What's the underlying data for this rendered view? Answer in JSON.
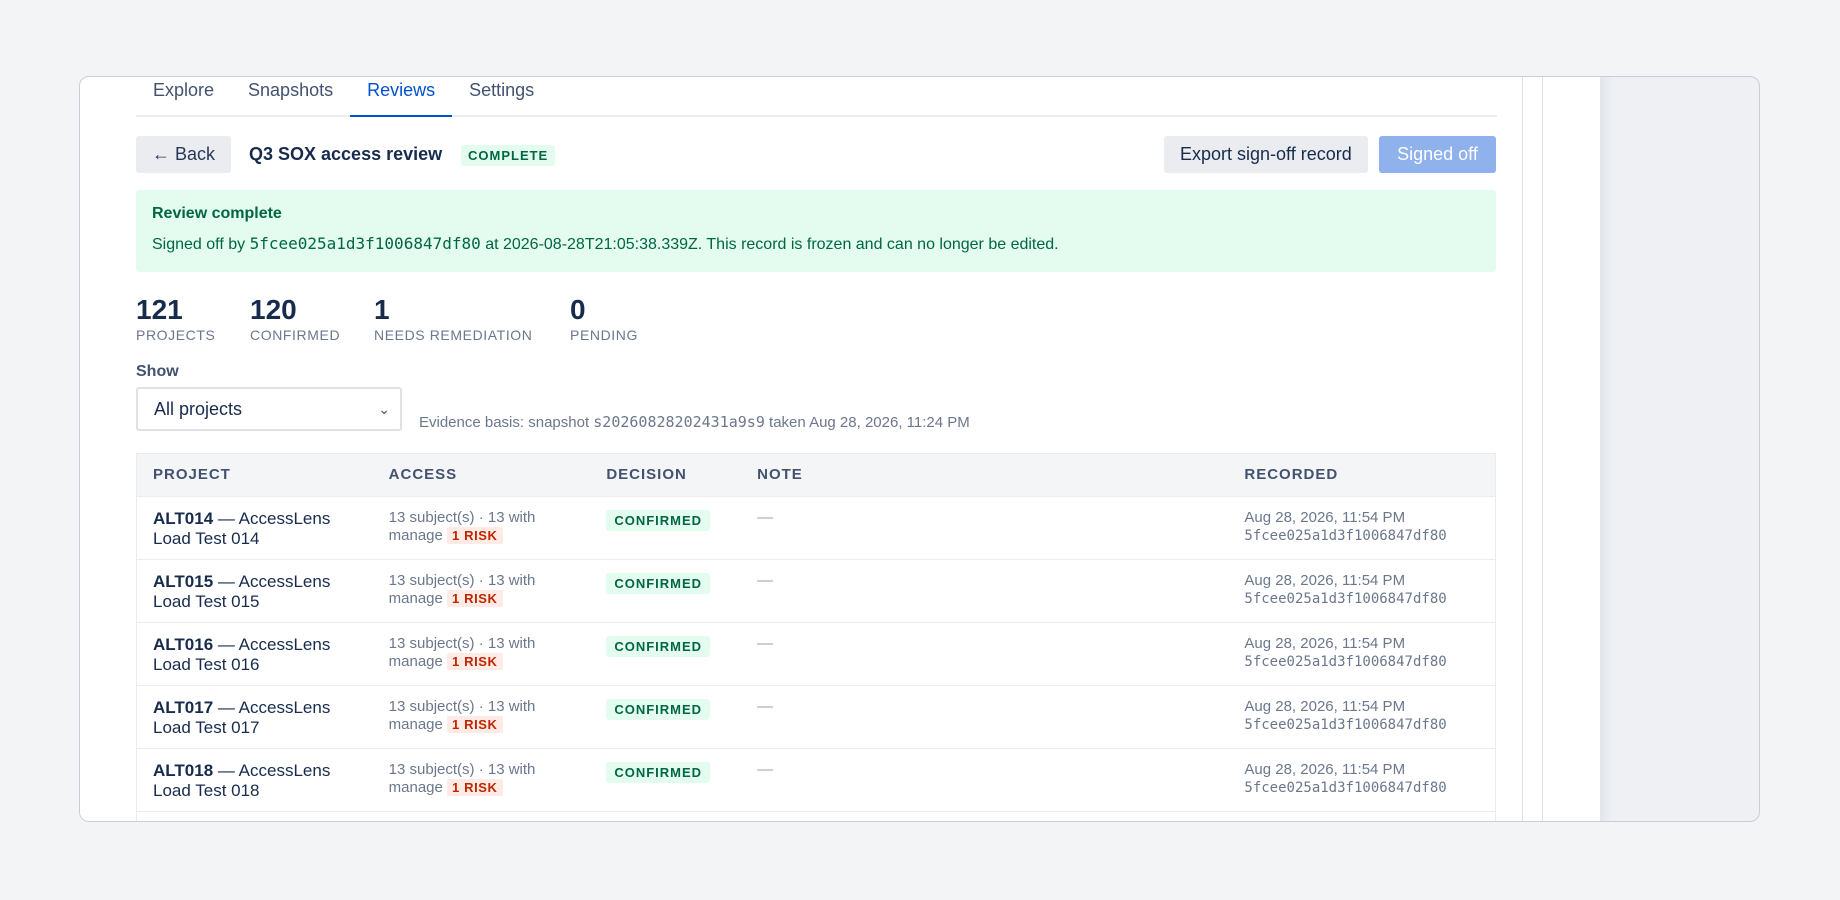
{
  "tabs": [
    {
      "label": "Explore"
    },
    {
      "label": "Snapshots"
    },
    {
      "label": "Reviews",
      "active": true
    },
    {
      "label": "Settings"
    }
  ],
  "header": {
    "back_label": "← Back",
    "title": "Q3 SOX access review",
    "status_badge": "COMPLETE",
    "export_label": "Export sign-off record",
    "signed_label": "Signed off"
  },
  "banner": {
    "title": "Review complete",
    "prefix": "Signed off by ",
    "signer": "5fcee025a1d3f1006847df80",
    "at_text": " at 2026-08-28T21:05:38.339Z. This record is frozen and can no longer be edited."
  },
  "stats": [
    {
      "value": "121",
      "label": "PROJECTS"
    },
    {
      "value": "120",
      "label": "CONFIRMED"
    },
    {
      "value": "1",
      "label": "NEEDS REMEDIATION"
    },
    {
      "value": "0",
      "label": "PENDING"
    }
  ],
  "filter": {
    "label": "Show",
    "selected": "All projects",
    "evidence_prefix": "Evidence basis: snapshot ",
    "snapshot_id": "s20260828202431a9s9",
    "evidence_suffix": " taken Aug 28, 2026, 11:24 PM"
  },
  "table": {
    "columns": [
      "PROJECT",
      "ACCESS",
      "DECISION",
      "NOTE",
      "RECORDED"
    ],
    "rows": [
      {
        "key": "ALT014",
        "name_line1": " — AccessLens",
        "name_line2": "Load Test 014",
        "access_line1": "13 subject(s) · 13 with",
        "access_line2": "manage",
        "risk": "1 RISK",
        "decision": "CONFIRMED",
        "note": "—",
        "recorded_date": "Aug 28, 2026, 11:54 PM",
        "recorded_by": "5fcee025a1d3f1006847df80"
      },
      {
        "key": "ALT015",
        "name_line1": " — AccessLens",
        "name_line2": "Load Test 015",
        "access_line1": "13 subject(s) · 13 with",
        "access_line2": "manage",
        "risk": "1 RISK",
        "decision": "CONFIRMED",
        "note": "—",
        "recorded_date": "Aug 28, 2026, 11:54 PM",
        "recorded_by": "5fcee025a1d3f1006847df80"
      },
      {
        "key": "ALT016",
        "name_line1": " — AccessLens",
        "name_line2": "Load Test 016",
        "access_line1": "13 subject(s) · 13 with",
        "access_line2": "manage",
        "risk": "1 RISK",
        "decision": "CONFIRMED",
        "note": "—",
        "recorded_date": "Aug 28, 2026, 11:54 PM",
        "recorded_by": "5fcee025a1d3f1006847df80"
      },
      {
        "key": "ALT017",
        "name_line1": " — AccessLens",
        "name_line2": "Load Test 017",
        "access_line1": "13 subject(s) · 13 with",
        "access_line2": "manage",
        "risk": "1 RISK",
        "decision": "CONFIRMED",
        "note": "—",
        "recorded_date": "Aug 28, 2026, 11:54 PM",
        "recorded_by": "5fcee025a1d3f1006847df80"
      },
      {
        "key": "ALT018",
        "name_line1": " — AccessLens",
        "name_line2": "Load Test 018",
        "access_line1": "13 subject(s) · 13 with",
        "access_line2": "manage",
        "risk": "1 RISK",
        "decision": "CONFIRMED",
        "note": "—",
        "recorded_date": "Aug 28, 2026, 11:54 PM",
        "recorded_by": "5fcee025a1d3f1006847df80"
      }
    ]
  },
  "icons": {
    "select_chevron": "chevron-down-icon"
  },
  "colors": {
    "accent": "#0052cc",
    "success_bg": "#e3fcef",
    "success_text": "#006644",
    "risk_bg": "#ffebe6",
    "risk_text": "#bf2600",
    "signed_button": "#8fb1ec"
  }
}
